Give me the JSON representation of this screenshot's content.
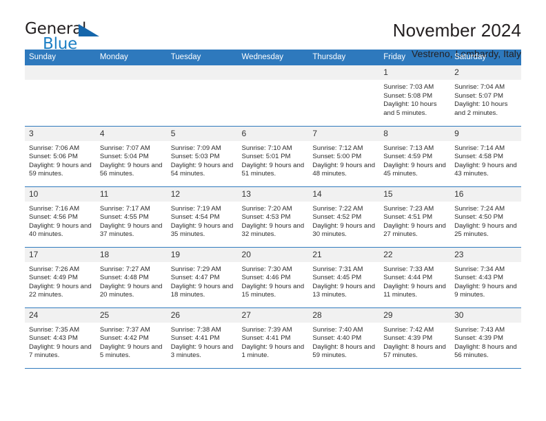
{
  "brand": {
    "word1": "General",
    "word2": "Blue",
    "accent_color": "#1c7fc4",
    "triangle_color": "#1566ab",
    "icon": "triangle-logo-icon"
  },
  "header": {
    "title": "November 2024",
    "location": "Vestreno, Lombardy, Italy"
  },
  "calendar": {
    "header_bg": "#2e79bd",
    "daynum_bg": "#f1f1f1",
    "row_border": "#2e79bd",
    "weekday_headers": [
      "Sunday",
      "Monday",
      "Tuesday",
      "Wednesday",
      "Thursday",
      "Friday",
      "Saturday"
    ],
    "weeks": [
      [
        {
          "day": "",
          "empty": true
        },
        {
          "day": "",
          "empty": true
        },
        {
          "day": "",
          "empty": true
        },
        {
          "day": "",
          "empty": true
        },
        {
          "day": "",
          "empty": true
        },
        {
          "day": "1",
          "sunrise": "Sunrise: 7:03 AM",
          "sunset": "Sunset: 5:08 PM",
          "daylight": "Daylight: 10 hours and 5 minutes."
        },
        {
          "day": "2",
          "sunrise": "Sunrise: 7:04 AM",
          "sunset": "Sunset: 5:07 PM",
          "daylight": "Daylight: 10 hours and 2 minutes."
        }
      ],
      [
        {
          "day": "3",
          "sunrise": "Sunrise: 7:06 AM",
          "sunset": "Sunset: 5:06 PM",
          "daylight": "Daylight: 9 hours and 59 minutes."
        },
        {
          "day": "4",
          "sunrise": "Sunrise: 7:07 AM",
          "sunset": "Sunset: 5:04 PM",
          "daylight": "Daylight: 9 hours and 56 minutes."
        },
        {
          "day": "5",
          "sunrise": "Sunrise: 7:09 AM",
          "sunset": "Sunset: 5:03 PM",
          "daylight": "Daylight: 9 hours and 54 minutes."
        },
        {
          "day": "6",
          "sunrise": "Sunrise: 7:10 AM",
          "sunset": "Sunset: 5:01 PM",
          "daylight": "Daylight: 9 hours and 51 minutes."
        },
        {
          "day": "7",
          "sunrise": "Sunrise: 7:12 AM",
          "sunset": "Sunset: 5:00 PM",
          "daylight": "Daylight: 9 hours and 48 minutes."
        },
        {
          "day": "8",
          "sunrise": "Sunrise: 7:13 AM",
          "sunset": "Sunset: 4:59 PM",
          "daylight": "Daylight: 9 hours and 45 minutes."
        },
        {
          "day": "9",
          "sunrise": "Sunrise: 7:14 AM",
          "sunset": "Sunset: 4:58 PM",
          "daylight": "Daylight: 9 hours and 43 minutes."
        }
      ],
      [
        {
          "day": "10",
          "sunrise": "Sunrise: 7:16 AM",
          "sunset": "Sunset: 4:56 PM",
          "daylight": "Daylight: 9 hours and 40 minutes."
        },
        {
          "day": "11",
          "sunrise": "Sunrise: 7:17 AM",
          "sunset": "Sunset: 4:55 PM",
          "daylight": "Daylight: 9 hours and 37 minutes."
        },
        {
          "day": "12",
          "sunrise": "Sunrise: 7:19 AM",
          "sunset": "Sunset: 4:54 PM",
          "daylight": "Daylight: 9 hours and 35 minutes."
        },
        {
          "day": "13",
          "sunrise": "Sunrise: 7:20 AM",
          "sunset": "Sunset: 4:53 PM",
          "daylight": "Daylight: 9 hours and 32 minutes."
        },
        {
          "day": "14",
          "sunrise": "Sunrise: 7:22 AM",
          "sunset": "Sunset: 4:52 PM",
          "daylight": "Daylight: 9 hours and 30 minutes."
        },
        {
          "day": "15",
          "sunrise": "Sunrise: 7:23 AM",
          "sunset": "Sunset: 4:51 PM",
          "daylight": "Daylight: 9 hours and 27 minutes."
        },
        {
          "day": "16",
          "sunrise": "Sunrise: 7:24 AM",
          "sunset": "Sunset: 4:50 PM",
          "daylight": "Daylight: 9 hours and 25 minutes."
        }
      ],
      [
        {
          "day": "17",
          "sunrise": "Sunrise: 7:26 AM",
          "sunset": "Sunset: 4:49 PM",
          "daylight": "Daylight: 9 hours and 22 minutes."
        },
        {
          "day": "18",
          "sunrise": "Sunrise: 7:27 AM",
          "sunset": "Sunset: 4:48 PM",
          "daylight": "Daylight: 9 hours and 20 minutes."
        },
        {
          "day": "19",
          "sunrise": "Sunrise: 7:29 AM",
          "sunset": "Sunset: 4:47 PM",
          "daylight": "Daylight: 9 hours and 18 minutes."
        },
        {
          "day": "20",
          "sunrise": "Sunrise: 7:30 AM",
          "sunset": "Sunset: 4:46 PM",
          "daylight": "Daylight: 9 hours and 15 minutes."
        },
        {
          "day": "21",
          "sunrise": "Sunrise: 7:31 AM",
          "sunset": "Sunset: 4:45 PM",
          "daylight": "Daylight: 9 hours and 13 minutes."
        },
        {
          "day": "22",
          "sunrise": "Sunrise: 7:33 AM",
          "sunset": "Sunset: 4:44 PM",
          "daylight": "Daylight: 9 hours and 11 minutes."
        },
        {
          "day": "23",
          "sunrise": "Sunrise: 7:34 AM",
          "sunset": "Sunset: 4:43 PM",
          "daylight": "Daylight: 9 hours and 9 minutes."
        }
      ],
      [
        {
          "day": "24",
          "sunrise": "Sunrise: 7:35 AM",
          "sunset": "Sunset: 4:43 PM",
          "daylight": "Daylight: 9 hours and 7 minutes."
        },
        {
          "day": "25",
          "sunrise": "Sunrise: 7:37 AM",
          "sunset": "Sunset: 4:42 PM",
          "daylight": "Daylight: 9 hours and 5 minutes."
        },
        {
          "day": "26",
          "sunrise": "Sunrise: 7:38 AM",
          "sunset": "Sunset: 4:41 PM",
          "daylight": "Daylight: 9 hours and 3 minutes."
        },
        {
          "day": "27",
          "sunrise": "Sunrise: 7:39 AM",
          "sunset": "Sunset: 4:41 PM",
          "daylight": "Daylight: 9 hours and 1 minute."
        },
        {
          "day": "28",
          "sunrise": "Sunrise: 7:40 AM",
          "sunset": "Sunset: 4:40 PM",
          "daylight": "Daylight: 8 hours and 59 minutes."
        },
        {
          "day": "29",
          "sunrise": "Sunrise: 7:42 AM",
          "sunset": "Sunset: 4:39 PM",
          "daylight": "Daylight: 8 hours and 57 minutes."
        },
        {
          "day": "30",
          "sunrise": "Sunrise: 7:43 AM",
          "sunset": "Sunset: 4:39 PM",
          "daylight": "Daylight: 8 hours and 56 minutes."
        }
      ]
    ]
  }
}
